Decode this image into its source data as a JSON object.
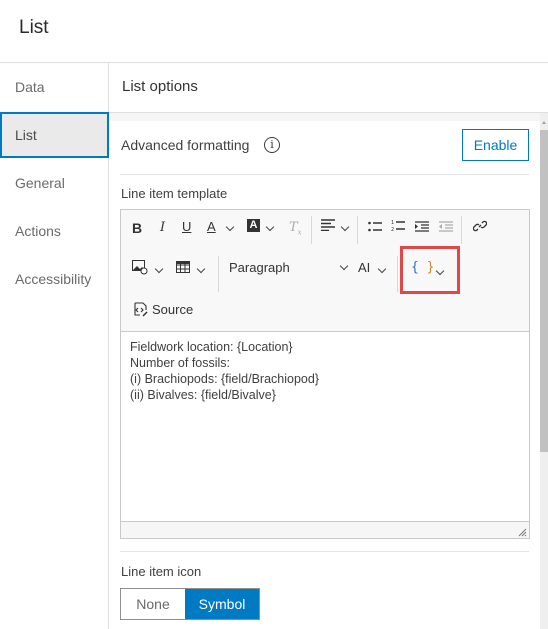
{
  "header": {
    "title": "List"
  },
  "sidebar": {
    "items": [
      {
        "label": "Data",
        "active": false
      },
      {
        "label": "List",
        "active": true
      },
      {
        "label": "General",
        "active": false
      },
      {
        "label": "Actions",
        "active": false
      },
      {
        "label": "Accessibility",
        "active": false
      }
    ]
  },
  "main": {
    "title": "List options",
    "advanced_formatting": {
      "label": "Advanced formatting",
      "button": "Enable",
      "info_icon": "info-icon"
    },
    "template": {
      "label": "Line item template",
      "toolbar": {
        "row1": [
          "bold-icon",
          "italic-icon",
          "underline-icon",
          "font-color-icon",
          "font-background-color-icon",
          "remove-format-icon",
          "alignment-icon",
          "bulleted-list-icon",
          "numbered-list-icon",
          "indent-icon",
          "outdent-icon",
          "link-icon"
        ],
        "row2": [
          "insert-image-icon",
          "insert-table-icon",
          "heading-dropdown",
          "font-size-icon",
          "insert-field-icon"
        ],
        "heading_value": "Paragraph",
        "source_label": "Source"
      },
      "content": [
        "Fieldwork location: {Location}",
        "Number of fossils:",
        "(i) Brachiopods: {field/Brachiopod}",
        "(ii) Bivalves: {field/Bivalve}"
      ]
    },
    "line_item_icon": {
      "label": "Line item icon",
      "options": [
        "None",
        "Symbol"
      ],
      "selected": "Symbol"
    }
  },
  "colors": {
    "accent": "#007ac2",
    "highlight": "#e04848"
  }
}
